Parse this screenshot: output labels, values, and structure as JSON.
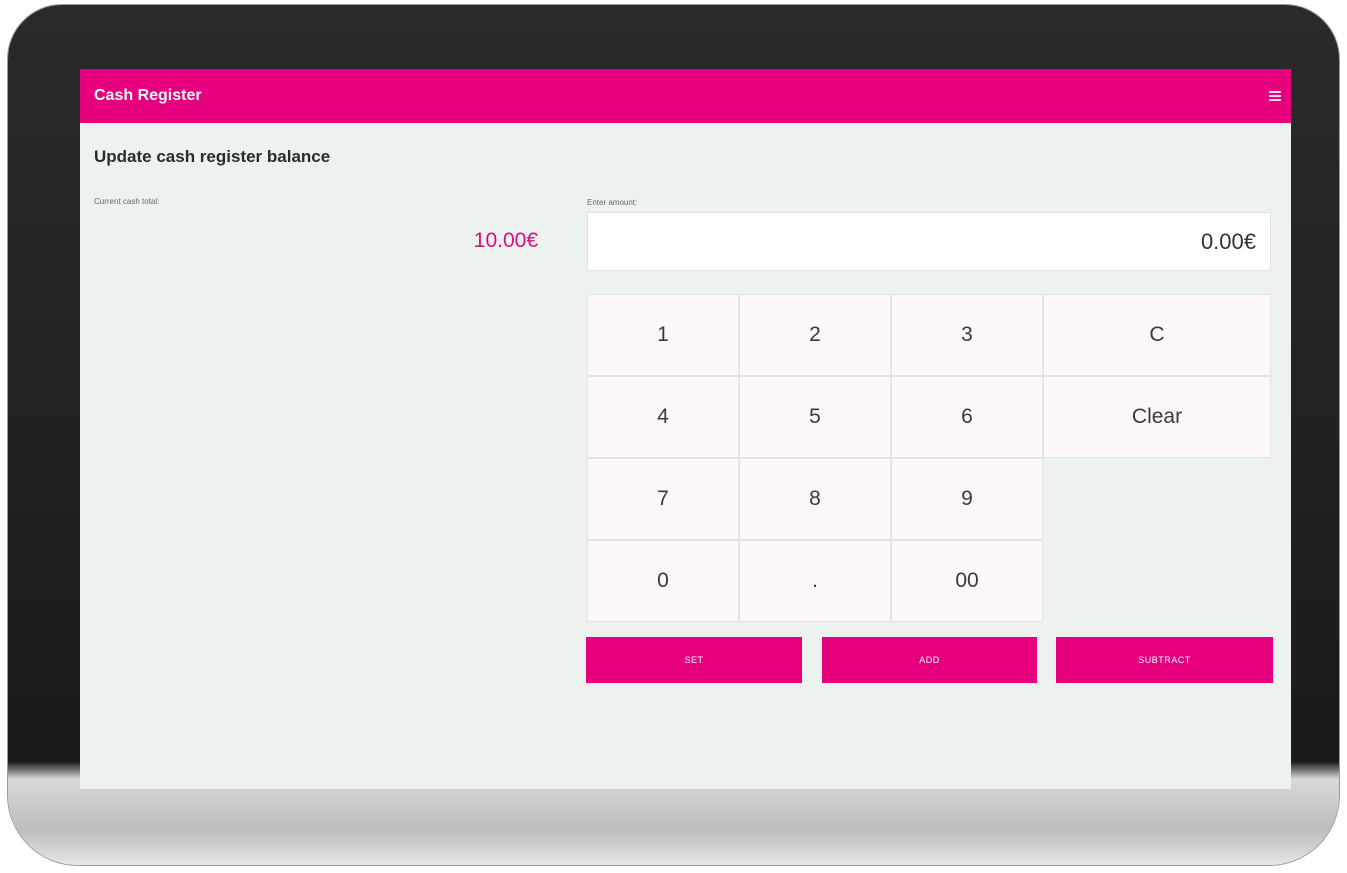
{
  "app": {
    "title": "Cash Register"
  },
  "page": {
    "title": "Update cash register balance"
  },
  "current": {
    "label": "Current cash total:",
    "value": "10.00€"
  },
  "amount": {
    "label": "Enter amount:",
    "value": "0.00€"
  },
  "keypad": {
    "keys": [
      "1",
      "2",
      "3",
      "4",
      "5",
      "6",
      "7",
      "8",
      "9",
      "0",
      ".",
      "00"
    ],
    "c": "C",
    "clear": "Clear"
  },
  "actions": {
    "set": "SET",
    "add": "ADD",
    "subtract": "SUBTRACT"
  },
  "colors": {
    "accent": "#e6007e",
    "background": "#eef2ee"
  }
}
